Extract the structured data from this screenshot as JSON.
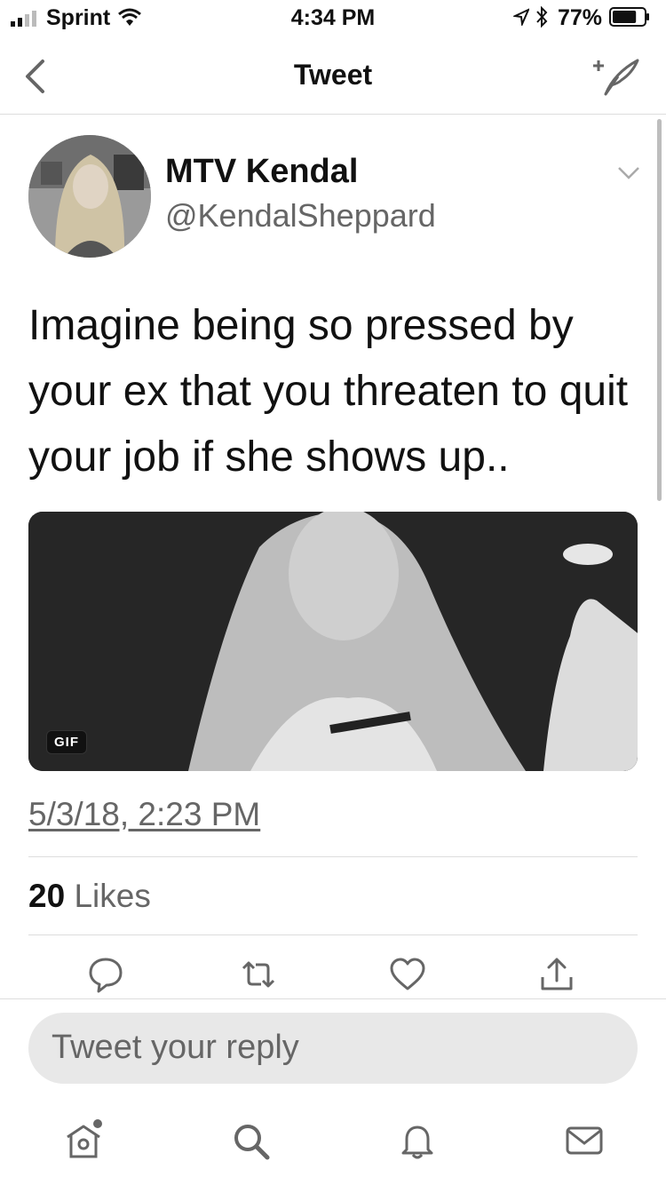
{
  "status_bar": {
    "carrier": "Sprint",
    "time": "4:34 PM",
    "battery_percent": "77%",
    "battery_level": 0.77,
    "icons": [
      "signal-icon",
      "wifi-icon",
      "location-arrow-icon",
      "bluetooth-icon",
      "battery-icon"
    ]
  },
  "nav": {
    "title": "Tweet",
    "back_icon": "chevron-left-icon",
    "compose_icon": "compose-feather-icon"
  },
  "tweet": {
    "author_name": "MTV Kendal",
    "author_handle": "@KendalSheppard",
    "text": "Imagine being so pressed by your ex that you threaten to quit your job if she shows up..",
    "media_badge": "GIF",
    "timestamp": "5/3/18, 2:23 PM",
    "likes_count": "20",
    "likes_label": "Likes"
  },
  "actions": [
    "reply-icon",
    "retweet-icon",
    "like-heart-icon",
    "share-icon"
  ],
  "reply": {
    "placeholder": "Tweet your reply"
  },
  "tab_bar": [
    "home-icon",
    "search-icon",
    "notifications-bell-icon",
    "messages-envelope-icon"
  ],
  "colors": {
    "text": "#111111",
    "secondary": "#666666",
    "divider": "#dddddd",
    "reply_box": "#e8e8e8"
  }
}
